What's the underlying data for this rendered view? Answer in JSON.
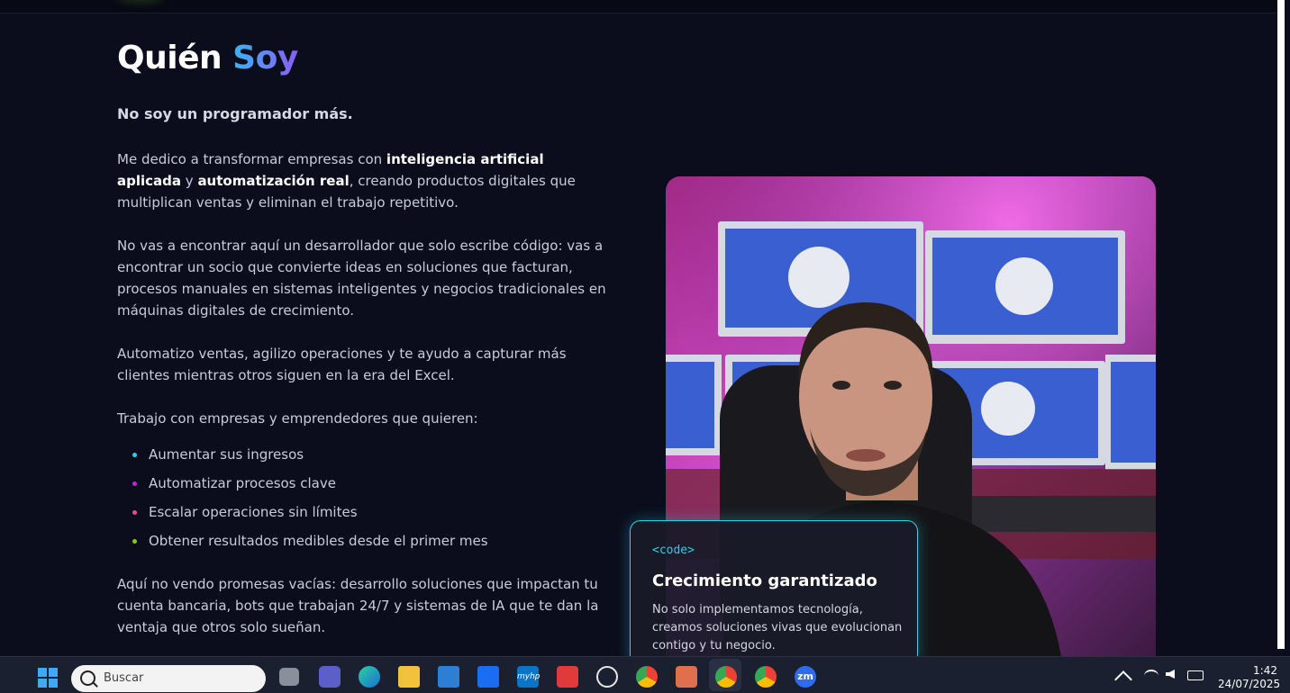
{
  "section": {
    "heading_prefix": "Quién ",
    "heading_accent": "Soy",
    "subtitle": "No soy un programador más.",
    "p1": {
      "a": "Me dedico a transformar empresas con ",
      "b1": "inteligencia artificial aplicada",
      "c": " y ",
      "b2": "automatización real",
      "d": ", creando productos digitales que multiplican ventas y eliminan el trabajo repetitivo."
    },
    "p2": "No vas a encontrar aquí un desarrollador que solo escribe código: vas a encontrar un socio que convierte ideas en soluciones que facturan, procesos manuales en sistemas inteligentes y negocios tradicionales en máquinas digitales de crecimiento.",
    "p3": "Automatizo ventas, agilizo operaciones y te ayudo a capturar más clientes mientras otros siguen en la era del Excel.",
    "p4": "Trabajo con empresas y emprendedores que quieren:",
    "bullets": [
      "Aumentar sus ingresos",
      "Automatizar procesos clave",
      "Escalar operaciones sin límites",
      "Obtener resultados medibles desde el primer mes"
    ],
    "bullet_colors": [
      "#22d3ee",
      "#c026d3",
      "#ec4899",
      "#84cc16"
    ],
    "p5": "Aquí no vendo promesas vacías: desarrollo soluciones que impactan tu cuenta bancaria, bots que trabajan 24/7 y sistemas de IA que te dan la ventaja que otros solo sueñan."
  },
  "card": {
    "code_tag": "<code>",
    "title": "Crecimiento garantizado",
    "description": "No solo implementamos tecnología, creamos soluciones vivas que evolucionan contigo y tu negocio."
  },
  "taskbar": {
    "search_placeholder": "Buscar",
    "time": "1:42",
    "date": "24/07/2025",
    "apps": [
      "task-view-icon",
      "teams-icon",
      "edge-icon",
      "file-explorer-icon",
      "mail-icon",
      "dropbox-icon",
      "myhp-icon",
      "wps-icon",
      "chatgpt-icon",
      "chrome-icon",
      "claude-icon",
      "chrome-profile-icon",
      "chrome-profile-2-icon",
      "zoom-icon"
    ],
    "myhp_label": "myhp",
    "zoom_label": "zm"
  },
  "colors": {
    "background": "#0b0d1c",
    "card_border": "#29d4e6",
    "accent_start": "#3ab4f2",
    "accent_end": "#8a5cf6"
  }
}
